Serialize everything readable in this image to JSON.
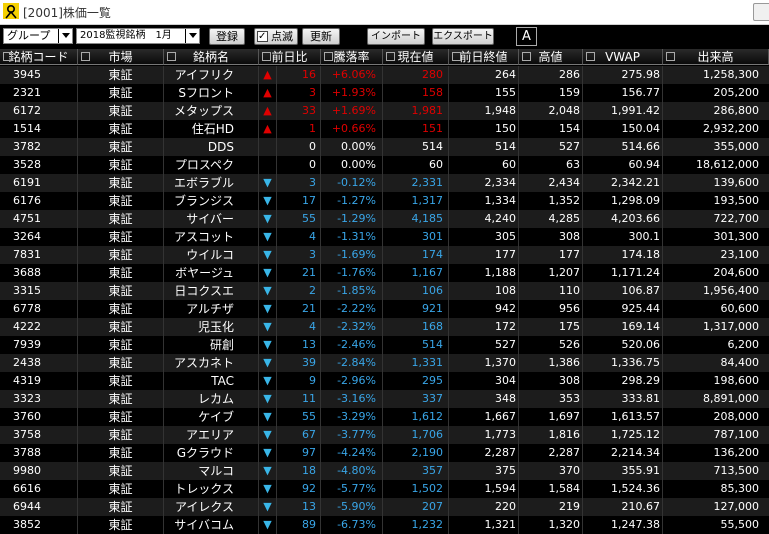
{
  "window": {
    "title": "[2001]株価一覧"
  },
  "toolbar": {
    "group_label": "グループ",
    "list_label": "2018監視銘柄　1月",
    "register_label": "登録",
    "blink_label": "点滅",
    "update_label": "更新",
    "import_label": "インポート",
    "export_label": "エクスポート",
    "mode_label": "A"
  },
  "columns": {
    "code": "銘柄コード",
    "market": "市場",
    "name": "銘柄名",
    "change": "前日比",
    "rate": "騰落率",
    "current": "現在値",
    "prev_close": "前日終値",
    "high": "高値",
    "vwap": "VWAP",
    "volume": "出来高"
  },
  "colors": {
    "up": "#e00000",
    "down": "#39a6e8",
    "neutral": "#ffffff"
  },
  "rows": [
    {
      "code": "3945",
      "market": "東証",
      "name": "アイフリク",
      "dir": "up",
      "mark": "▲",
      "change": "16",
      "rate": "+6.06%",
      "current": "280",
      "prev": "264",
      "high": "286",
      "vwap": "275.98",
      "volume": "1,258,300"
    },
    {
      "code": "2321",
      "market": "東証",
      "name": "Sフロント",
      "dir": "up",
      "mark": "▲",
      "change": "3",
      "rate": "+1.93%",
      "current": "158",
      "prev": "155",
      "high": "159",
      "vwap": "156.77",
      "volume": "205,200"
    },
    {
      "code": "6172",
      "market": "東証",
      "name": "メタップス",
      "dir": "up",
      "mark": "▲",
      "change": "33",
      "rate": "+1.69%",
      "current": "1,981",
      "prev": "1,948",
      "high": "2,048",
      "vwap": "1,991.42",
      "volume": "286,800"
    },
    {
      "code": "1514",
      "market": "東証",
      "name": "住石HD",
      "dir": "up",
      "mark": "▲",
      "change": "1",
      "rate": "+0.66%",
      "current": "151",
      "prev": "150",
      "high": "154",
      "vwap": "150.04",
      "volume": "2,932,200"
    },
    {
      "code": "3782",
      "market": "東証",
      "name": "DDS",
      "dir": "flat",
      "mark": "",
      "change": "0",
      "rate": "0.00%",
      "current": "514",
      "prev": "514",
      "high": "527",
      "vwap": "514.66",
      "volume": "355,000"
    },
    {
      "code": "3528",
      "market": "東証",
      "name": "プロスペク",
      "dir": "flat",
      "mark": "",
      "change": "0",
      "rate": "0.00%",
      "current": "60",
      "prev": "60",
      "high": "63",
      "vwap": "60.94",
      "volume": "18,612,000"
    },
    {
      "code": "6191",
      "market": "東証",
      "name": "エボラブル",
      "dir": "down",
      "mark": "▼",
      "change": "3",
      "rate": "-0.12%",
      "current": "2,331",
      "prev": "2,334",
      "high": "2,434",
      "vwap": "2,342.21",
      "volume": "139,600"
    },
    {
      "code": "6176",
      "market": "東証",
      "name": "ブランジス",
      "dir": "down",
      "mark": "▼",
      "change": "17",
      "rate": "-1.27%",
      "current": "1,317",
      "prev": "1,334",
      "high": "1,352",
      "vwap": "1,298.09",
      "volume": "193,500"
    },
    {
      "code": "4751",
      "market": "東証",
      "name": "サイバー",
      "dir": "down",
      "mark": "▼",
      "change": "55",
      "rate": "-1.29%",
      "current": "4,185",
      "prev": "4,240",
      "high": "4,285",
      "vwap": "4,203.66",
      "volume": "722,700"
    },
    {
      "code": "3264",
      "market": "東証",
      "name": "アスコット",
      "dir": "down",
      "mark": "▼",
      "change": "4",
      "rate": "-1.31%",
      "current": "301",
      "prev": "305",
      "high": "308",
      "vwap": "300.1",
      "volume": "301,300"
    },
    {
      "code": "7831",
      "market": "東証",
      "name": "ウイルコ",
      "dir": "down",
      "mark": "▼",
      "change": "3",
      "rate": "-1.69%",
      "current": "174",
      "prev": "177",
      "high": "177",
      "vwap": "174.18",
      "volume": "23,100"
    },
    {
      "code": "3688",
      "market": "東証",
      "name": "ボヤージュ",
      "dir": "down",
      "mark": "▼",
      "change": "21",
      "rate": "-1.76%",
      "current": "1,167",
      "prev": "1,188",
      "high": "1,207",
      "vwap": "1,171.24",
      "volume": "204,600"
    },
    {
      "code": "3315",
      "market": "東証",
      "name": "日コクスエ",
      "dir": "down",
      "mark": "▼",
      "change": "2",
      "rate": "-1.85%",
      "current": "106",
      "prev": "108",
      "high": "110",
      "vwap": "106.87",
      "volume": "1,956,400"
    },
    {
      "code": "6778",
      "market": "東証",
      "name": "アルチザ",
      "dir": "down",
      "mark": "▼",
      "change": "21",
      "rate": "-2.22%",
      "current": "921",
      "prev": "942",
      "high": "956",
      "vwap": "925.44",
      "volume": "60,600"
    },
    {
      "code": "4222",
      "market": "東証",
      "name": "児玉化",
      "dir": "down",
      "mark": "▼",
      "change": "4",
      "rate": "-2.32%",
      "current": "168",
      "prev": "172",
      "high": "175",
      "vwap": "169.14",
      "volume": "1,317,000"
    },
    {
      "code": "7939",
      "market": "東証",
      "name": "研創",
      "dir": "down",
      "mark": "▼",
      "change": "13",
      "rate": "-2.46%",
      "current": "514",
      "prev": "527",
      "high": "526",
      "vwap": "520.06",
      "volume": "6,200"
    },
    {
      "code": "2438",
      "market": "東証",
      "name": "アスカネト",
      "dir": "down",
      "mark": "▼",
      "change": "39",
      "rate": "-2.84%",
      "current": "1,331",
      "prev": "1,370",
      "high": "1,386",
      "vwap": "1,336.75",
      "volume": "84,400"
    },
    {
      "code": "4319",
      "market": "東証",
      "name": "TAC",
      "dir": "down",
      "mark": "▼",
      "change": "9",
      "rate": "-2.96%",
      "current": "295",
      "prev": "304",
      "high": "308",
      "vwap": "298.29",
      "volume": "198,600"
    },
    {
      "code": "3323",
      "market": "東証",
      "name": "レカム",
      "dir": "down",
      "mark": "▼",
      "change": "11",
      "rate": "-3.16%",
      "current": "337",
      "prev": "348",
      "high": "353",
      "vwap": "333.81",
      "volume": "8,891,000"
    },
    {
      "code": "3760",
      "market": "東証",
      "name": "ケイブ",
      "dir": "down",
      "mark": "▼",
      "change": "55",
      "rate": "-3.29%",
      "current": "1,612",
      "prev": "1,667",
      "high": "1,697",
      "vwap": "1,613.57",
      "volume": "208,000"
    },
    {
      "code": "3758",
      "market": "東証",
      "name": "アエリア",
      "dir": "down",
      "mark": "▼",
      "change": "67",
      "rate": "-3.77%",
      "current": "1,706",
      "prev": "1,773",
      "high": "1,816",
      "vwap": "1,725.12",
      "volume": "787,100"
    },
    {
      "code": "3788",
      "market": "東証",
      "name": "Gクラウド",
      "dir": "down",
      "mark": "▼",
      "change": "97",
      "rate": "-4.24%",
      "current": "2,190",
      "prev": "2,287",
      "high": "2,287",
      "vwap": "2,214.34",
      "volume": "136,200"
    },
    {
      "code": "9980",
      "market": "東証",
      "name": "マルコ",
      "dir": "down",
      "mark": "▼",
      "change": "18",
      "rate": "-4.80%",
      "current": "357",
      "prev": "375",
      "high": "370",
      "vwap": "355.91",
      "volume": "713,500"
    },
    {
      "code": "6616",
      "market": "東証",
      "name": "トレックス",
      "dir": "down",
      "mark": "▼",
      "change": "92",
      "rate": "-5.77%",
      "current": "1,502",
      "prev": "1,594",
      "high": "1,584",
      "vwap": "1,524.36",
      "volume": "85,300"
    },
    {
      "code": "6944",
      "market": "東証",
      "name": "アイレクス",
      "dir": "down",
      "mark": "▼",
      "change": "13",
      "rate": "-5.90%",
      "current": "207",
      "prev": "220",
      "high": "219",
      "vwap": "210.67",
      "volume": "127,000"
    },
    {
      "code": "3852",
      "market": "東証",
      "name": "サイバコム",
      "dir": "down",
      "mark": "▼",
      "change": "89",
      "rate": "-6.73%",
      "current": "1,232",
      "prev": "1,321",
      "high": "1,320",
      "vwap": "1,247.38",
      "volume": "55,500"
    }
  ]
}
